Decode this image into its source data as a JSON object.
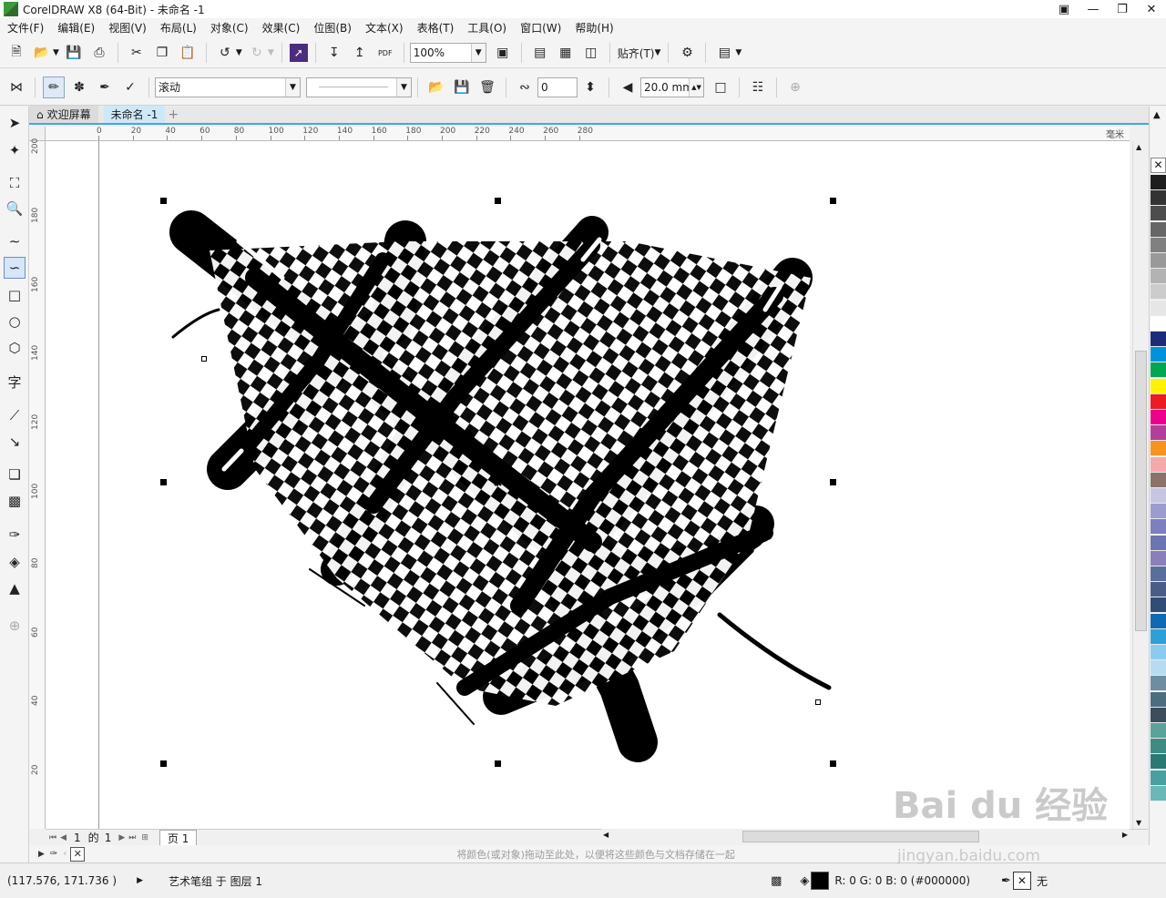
{
  "window": {
    "title": "CorelDRAW X8 (64-Bit) - 未命名 -1",
    "controls": [
      "minimize-icon",
      "restore-icon",
      "close-icon"
    ]
  },
  "menubar": {
    "items": [
      "文件(F)",
      "编辑(E)",
      "视图(V)",
      "布局(L)",
      "对象(C)",
      "效果(C)",
      "位图(B)",
      "文本(X)",
      "表格(T)",
      "工具(O)",
      "窗口(W)",
      "帮助(H)"
    ]
  },
  "toolbar1": {
    "zoom_value": "100%",
    "snap_label": "贴齐(T)",
    "pdf_label": "PDF"
  },
  "toolbar2": {
    "brush_type": "滚动",
    "smoothing_value": "0",
    "width_value": "20.0 mm"
  },
  "tabs": {
    "welcome": "欢迎屏幕",
    "document": "未命名 -1",
    "add": "+"
  },
  "ruler_h": {
    "labels": [
      "0",
      "20",
      "40",
      "60",
      "80",
      "100",
      "120",
      "140",
      "160",
      "180",
      "200",
      "220",
      "240",
      "260",
      "280"
    ],
    "unit_label": "毫米"
  },
  "ruler_v": {
    "labels": [
      "200",
      "180",
      "160",
      "140",
      "120",
      "100",
      "80",
      "60",
      "40",
      "20"
    ]
  },
  "page_nav": {
    "current": "1",
    "of_label": "的",
    "total": "1",
    "page_tab": "页 1"
  },
  "color_hint": "将颜色(或对象)拖动至此处，以便将这些颜色与文档存储在一起",
  "status": {
    "coords": "(117.576, 171.736 )",
    "selection": "艺术笔组 于 图层 1",
    "fill_color": "R: 0 G: 0 B: 0 (#000000)",
    "outline_label": "无"
  },
  "palette_colors": [
    "#1e1e1e",
    "#333333",
    "#4d4d4d",
    "#666666",
    "#808080",
    "#999999",
    "#b3b3b3",
    "#cccccc",
    "#e6e6e6",
    "#ffffff",
    "#1d2c7a",
    "#0093dd",
    "#00a651",
    "#fff200",
    "#ed1c24",
    "#ec008c",
    "#b33f9a",
    "#f7941d",
    "#f6a9a9",
    "#8c7268",
    "#c7c6e2",
    "#9c9ccf",
    "#7e7fbd",
    "#6b75b2",
    "#8a7fb8",
    "#5a6e9e",
    "#4a5d88",
    "#2f4d77",
    "#0f6ab4",
    "#2ea0d8",
    "#8ccbf0",
    "#b8dcef",
    "#6f8da0",
    "#4c6d7f",
    "#3a4e5c",
    "#5aa39a",
    "#3d8c84",
    "#2a7a73",
    "#48a0a0",
    "#6ab8b8"
  ],
  "watermark": {
    "main": "Bai du 经验",
    "sub": "jingyan.baidu.com"
  }
}
